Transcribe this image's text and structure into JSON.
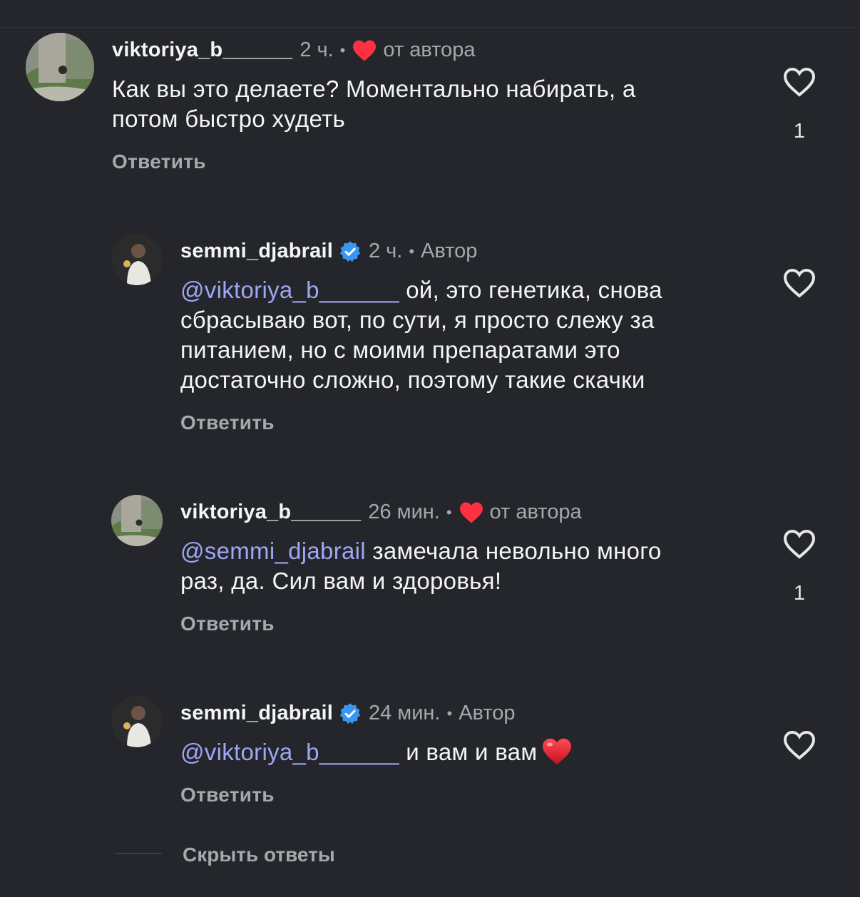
{
  "comments": [
    {
      "username": "viktoriya_b______",
      "time": "2 ч.",
      "badge": "от автора",
      "mention": "",
      "text_lines": [
        "Как вы это делаете? Моментально набирать, а",
        "потом быстро худеть"
      ],
      "reply_label": "Ответить",
      "like_count": "1"
    },
    {
      "username": "semmi_djabrail",
      "time": "2 ч.",
      "badge": "Автор",
      "mention": "@viktoriya_b______",
      "text_first": " ой, это генетика, снова",
      "text_lines": [
        "сбрасываю вот, по сути, я просто слежу за",
        "питанием, но с моими препаратами это",
        "достаточно сложно, поэтому такие скачки"
      ],
      "reply_label": "Ответить",
      "like_count": ""
    },
    {
      "username": "viktoriya_b______",
      "time": "26 мин.",
      "badge": "от автора",
      "mention": "@semmi_djabrail",
      "text_first": " замечала невольно много",
      "text_lines": [
        "раз, да. Сил вам и здоровья!"
      ],
      "reply_label": "Ответить",
      "like_count": "1"
    },
    {
      "username": "semmi_djabrail",
      "time": "24 мин.",
      "badge": "Автор",
      "mention": "@viktoriya_b______",
      "text_first": " и вам и вам",
      "text_lines": [],
      "reply_label": "Ответить",
      "like_count": ""
    }
  ],
  "hide_replies_label": "Скрыть ответы",
  "colors": {
    "background": "#24262b",
    "mention": "#9ea7f3",
    "verified": "#3897f0",
    "heart_red": "#ff3040"
  }
}
